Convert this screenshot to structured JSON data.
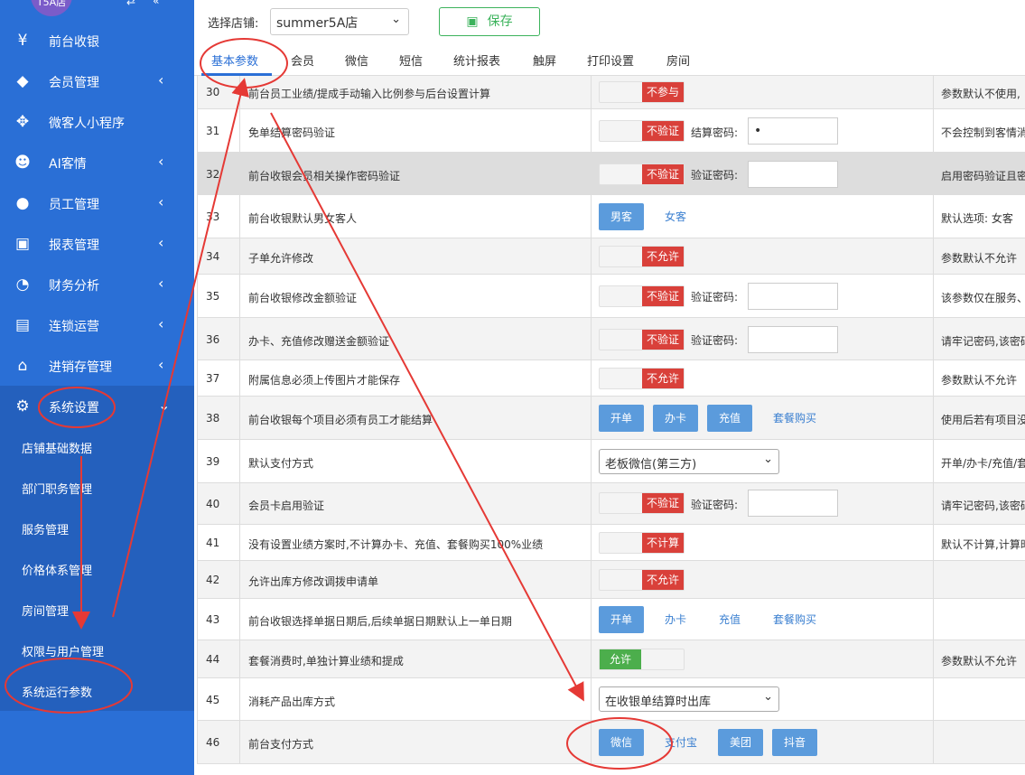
{
  "sidebar": {
    "avatar_text": "T5A店",
    "items": [
      {
        "label": "前台收银",
        "icon": "money-icon"
      },
      {
        "label": "会员管理",
        "icon": "diamond-icon"
      },
      {
        "label": "微客人小程序",
        "icon": "grid-icon"
      },
      {
        "label": "AI客情",
        "icon": "user-cog-icon"
      },
      {
        "label": "员工管理",
        "icon": "user-icon"
      },
      {
        "label": "报表管理",
        "icon": "monitor-icon"
      },
      {
        "label": "财务分析",
        "icon": "pie-chart-icon"
      },
      {
        "label": "连锁运营",
        "icon": "building-icon"
      },
      {
        "label": "进销存管理",
        "icon": "home-icon"
      },
      {
        "label": "系统设置",
        "icon": "gear-icon"
      }
    ],
    "sub_items": [
      "店铺基础数据",
      "部门职务管理",
      "服务管理",
      "价格体系管理",
      "房间管理",
      "权限与用户管理",
      "系统运行参数"
    ]
  },
  "topbar": {
    "store_label": "选择店铺:",
    "store_value": "summer5A店",
    "save_label": "保存"
  },
  "tabs": [
    "基本参数",
    "会员",
    "微信",
    "短信",
    "统计报表",
    "触屏",
    "打印设置",
    "房间"
  ],
  "rows": [
    {
      "num": "30",
      "name": "前台员工业绩/提成手动输入比例参与后台设置计算",
      "toggle": "不参与",
      "desc": "参数默认不使用,"
    },
    {
      "num": "31",
      "name": "免单结算密码验证",
      "toggle": "不验证",
      "pw_label": "结算密码:",
      "pw_value": "•",
      "desc": "不会控制到客情消"
    },
    {
      "num": "32",
      "name": "前台收银会员相关操作密码验证",
      "toggle": "不验证",
      "pw_label": "验证密码:",
      "pw_value": "",
      "desc": "启用密码验证且密"
    },
    {
      "num": "33",
      "name": "前台收银默认男女客人",
      "buttons": [
        "男客"
      ],
      "links": [
        "女客"
      ],
      "desc": "默认选项: 女客"
    },
    {
      "num": "34",
      "name": "子单允许修改",
      "toggle": "不允许",
      "desc": "参数默认不允许"
    },
    {
      "num": "35",
      "name": "前台收银修改金额验证",
      "toggle": "不验证",
      "pw_label": "验证密码:",
      "pw_value": "",
      "desc": "该参数仅在服务、"
    },
    {
      "num": "36",
      "name": "办卡、充值修改赠送金额验证",
      "toggle": "不验证",
      "pw_label": "验证密码:",
      "pw_value": "",
      "desc": "请牢记密码,该密码"
    },
    {
      "num": "37",
      "name": "附属信息必须上传图片才能保存",
      "toggle": "不允许",
      "desc": "参数默认不允许"
    },
    {
      "num": "38",
      "name": "前台收银每个项目必须有员工才能结算",
      "buttons": [
        "开单",
        "办卡",
        "充值"
      ],
      "links": [
        "套餐购买"
      ],
      "desc": "使用后若有项目没"
    },
    {
      "num": "39",
      "name": "默认支付方式",
      "select": "老板微信(第三方)",
      "desc": "开单/办卡/充值/套"
    },
    {
      "num": "40",
      "name": "会员卡启用验证",
      "toggle": "不验证",
      "pw_label": "验证密码:",
      "pw_value": "",
      "desc": "请牢记密码,该密码"
    },
    {
      "num": "41",
      "name": "没有设置业绩方案时,不计算办卡、充值、套餐购买100%业绩",
      "toggle": "不计算",
      "desc": "默认不计算,计算时"
    },
    {
      "num": "42",
      "name": "允许出库方修改调拨申请单",
      "toggle": "不允许",
      "desc": ""
    },
    {
      "num": "43",
      "name": "前台收银选择单据日期后,后续单据日期默认上一单日期",
      "buttons": [
        "开单"
      ],
      "links": [
        "办卡",
        "充值",
        "套餐购买"
      ],
      "desc": ""
    },
    {
      "num": "44",
      "name": "套餐消费时,单独计算业绩和提成",
      "toggle_on": "允许",
      "desc": "参数默认不允许"
    },
    {
      "num": "45",
      "name": "消耗产品出库方式",
      "select": "在收银单结算时出库",
      "desc": ""
    },
    {
      "num": "46",
      "name": "前台支付方式",
      "pay": [
        "微信",
        "支付宝",
        "美团",
        "抖音"
      ],
      "desc": ""
    }
  ],
  "colors": {
    "sidebar": "#2a6fd6",
    "accent": "#2a6fd6",
    "danger": "#d9403a",
    "success": "#4cae4c",
    "annotation": "#e53935"
  }
}
